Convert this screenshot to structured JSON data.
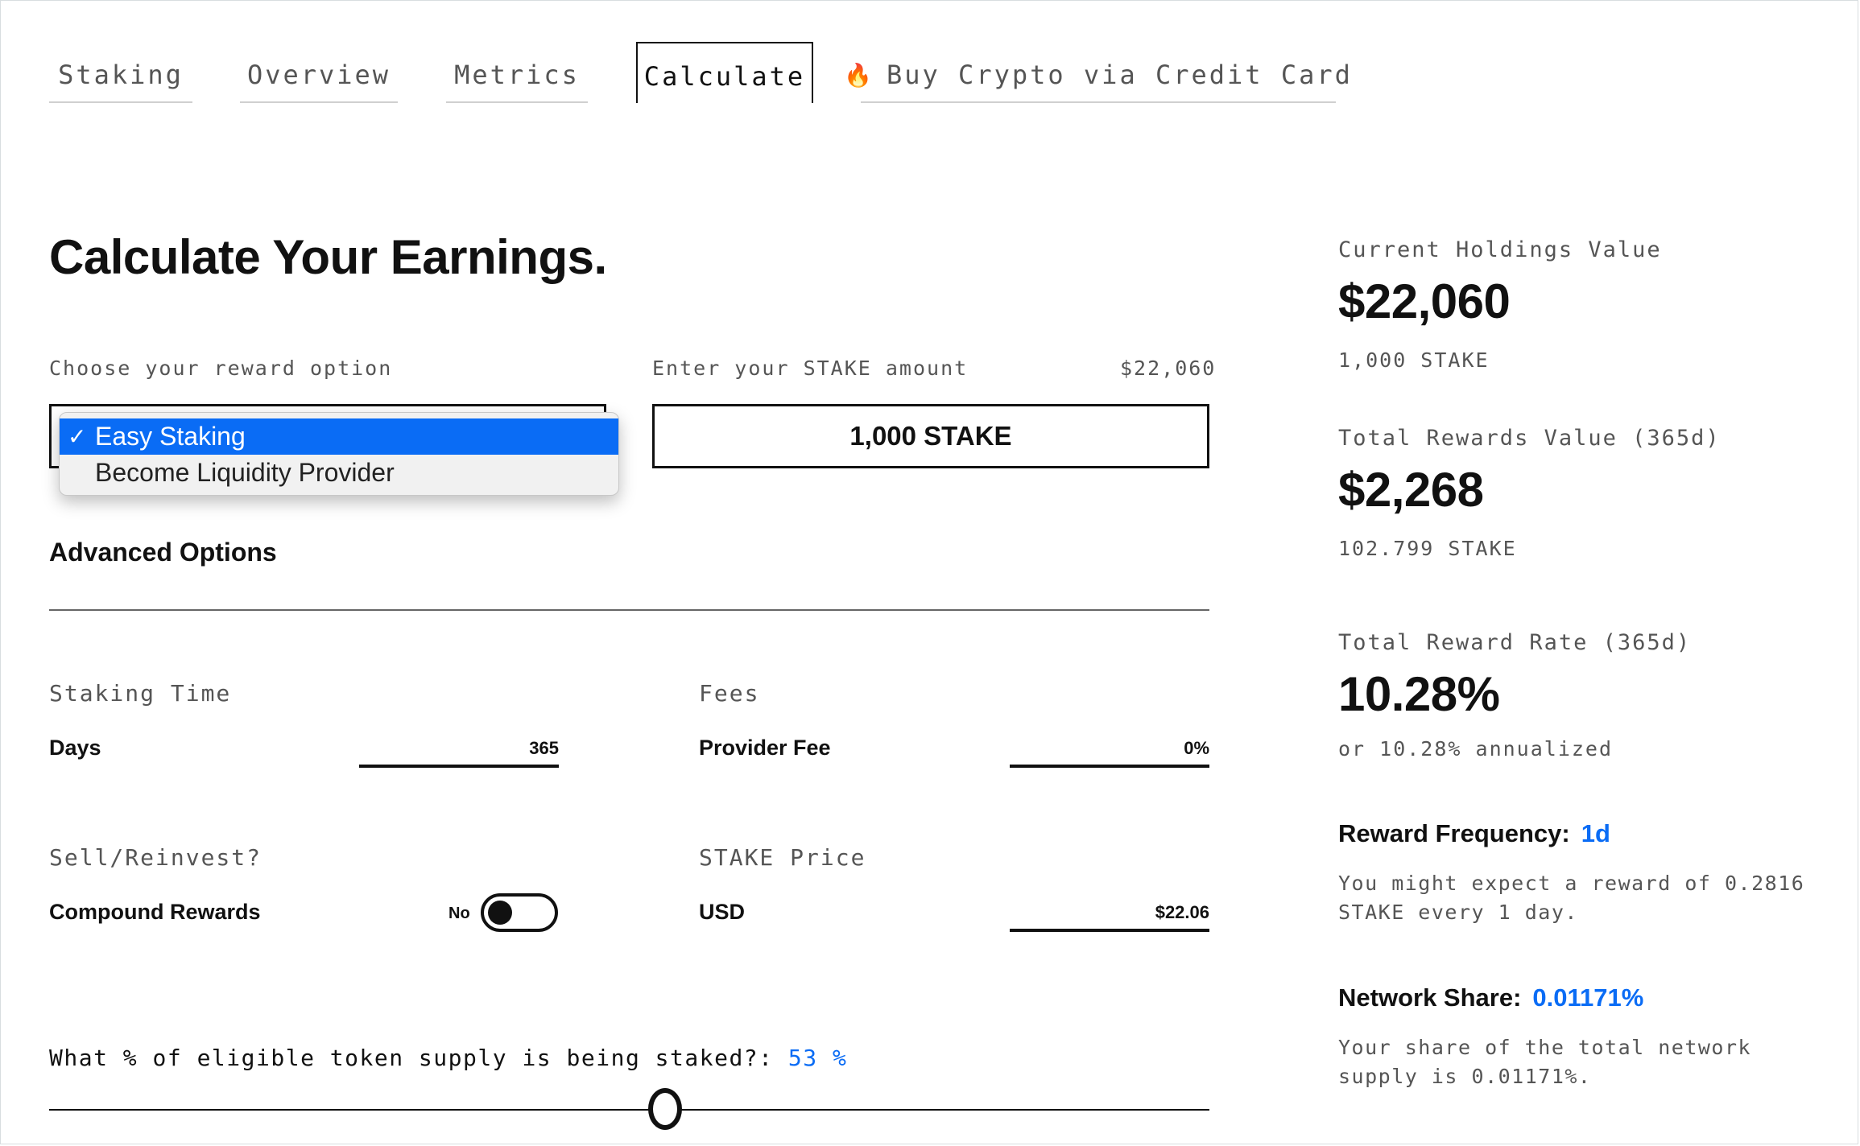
{
  "tabs": [
    {
      "label": "Staking",
      "active": false
    },
    {
      "label": "Overview",
      "active": false
    },
    {
      "label": "Metrics",
      "active": false
    },
    {
      "label": "Calculate",
      "active": true
    },
    {
      "label": "Buy Crypto via Credit Card",
      "active": false,
      "icon": "fire-icon",
      "icon_glyph": "🔥"
    }
  ],
  "page_title": "Calculate Your Earnings.",
  "reward_option": {
    "label": "Choose your reward option",
    "options": [
      "Easy Staking",
      "Become Liquidity Provider"
    ],
    "selected": "Easy Staking",
    "check": "✓"
  },
  "stake_amount": {
    "label": "Enter your STAKE amount",
    "usd_value": "$22,060",
    "value": "1,000 STAKE"
  },
  "advanced": {
    "title": "Advanced Options",
    "staking_time": {
      "section": "Staking Time",
      "label": "Days",
      "value": "365"
    },
    "fees": {
      "section": "Fees",
      "label": "Provider Fee",
      "value": "0%"
    },
    "sell_reinvest": {
      "section": "Sell/Reinvest?",
      "label": "Compound Rewards",
      "toggle_state": "No"
    },
    "stake_price": {
      "section": "STAKE Price",
      "label": "USD",
      "value": "$22.06"
    }
  },
  "supply": {
    "question": "What % of eligible token supply is being staked?:",
    "value": "53 %",
    "fraction": 0.53
  },
  "summary": {
    "holdings": {
      "label": "Current Holdings Value",
      "value": "$22,060",
      "sub": "1,000 STAKE"
    },
    "rewards": {
      "label": "Total Rewards Value (365d)",
      "value": "$2,268",
      "sub": "102.799 STAKE"
    },
    "rate": {
      "label": "Total Reward Rate (365d)",
      "value": "10.28%",
      "sub": "or 10.28% annualized"
    },
    "frequency": {
      "label": "Reward Frequency:",
      "value": "1d",
      "desc": "You might expect a reward of 0.2816 STAKE every 1 day."
    },
    "network": {
      "label": "Network Share:",
      "value": "0.01171%",
      "desc": "Your share of the total network supply is 0.01171%."
    }
  },
  "colors": {
    "accent": "#0a6cf5",
    "text": "#111111",
    "muted": "#555555"
  }
}
